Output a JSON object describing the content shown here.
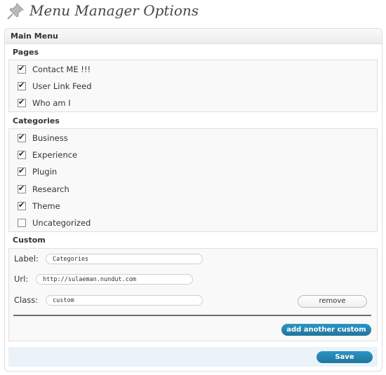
{
  "header": {
    "title": "Menu Manager Options",
    "icon": "pushpin-icon"
  },
  "box": {
    "title": "Main Menu"
  },
  "pages": {
    "label": "Pages",
    "items": [
      {
        "label": "Contact ME !!!",
        "checked": true
      },
      {
        "label": "User Link Feed",
        "checked": true
      },
      {
        "label": "Who am I",
        "checked": true
      }
    ]
  },
  "categories": {
    "label": "Categories",
    "items": [
      {
        "label": "Business",
        "checked": true
      },
      {
        "label": "Experience",
        "checked": true
      },
      {
        "label": "Plugin",
        "checked": true
      },
      {
        "label": "Research",
        "checked": true
      },
      {
        "label": "Theme",
        "checked": true
      },
      {
        "label": "Uncategorized",
        "checked": false
      }
    ]
  },
  "custom": {
    "label": "Custom",
    "label_field": {
      "label": "Label:",
      "value": "Categories"
    },
    "url_field": {
      "label": "Url:",
      "value": "http://sulaeman.nundut.com"
    },
    "class_field": {
      "label": "Class:",
      "value": "custom"
    },
    "remove_label": "remove",
    "add_label": "add another custom"
  },
  "save_label": "Save",
  "colors": {
    "accent": "#21759b",
    "save_bar": "#eaf2fa"
  }
}
